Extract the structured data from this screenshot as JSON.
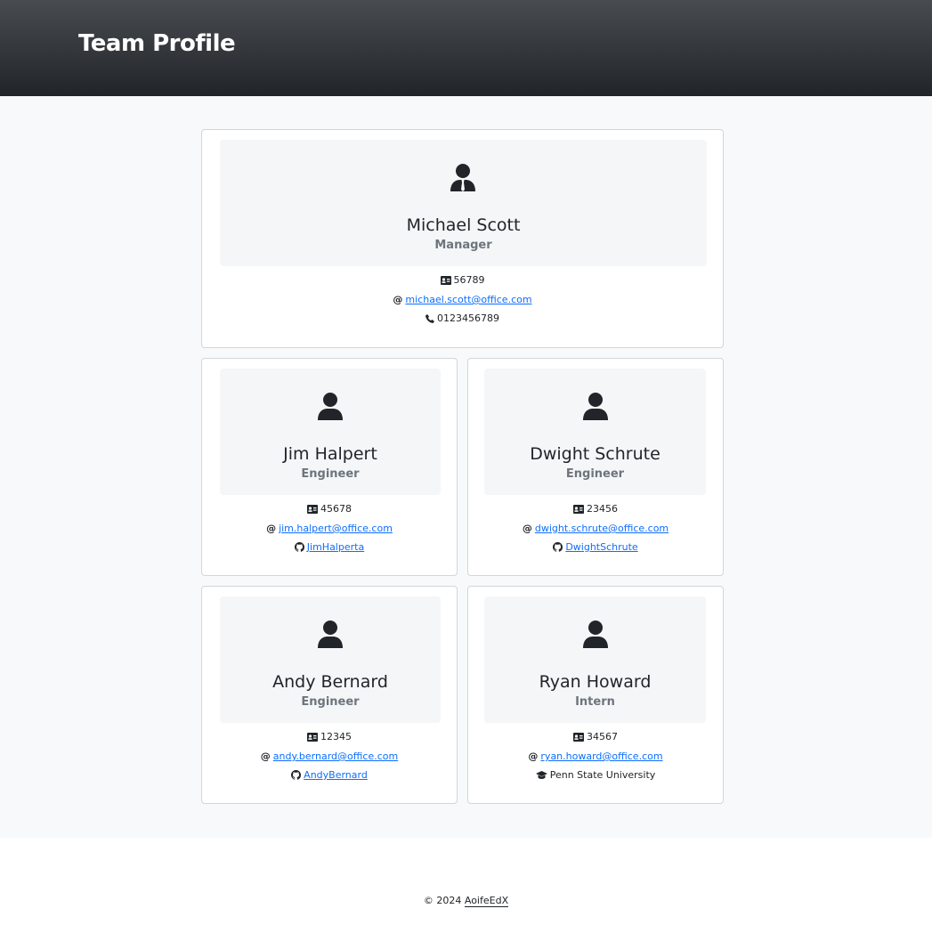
{
  "header": {
    "title": "Team Profile"
  },
  "manager": {
    "name": "Michael Scott",
    "role": "Manager",
    "id": "56789",
    "email": "michael.scott@office.com",
    "phone": "0123456789",
    "icon": "user-tie-icon"
  },
  "engineers": [
    {
      "name": "Jim Halpert",
      "role": "Engineer",
      "id": "45678",
      "email": "jim.halpert@office.com",
      "github": "JimHalperta",
      "icon": "user-icon"
    },
    {
      "name": "Dwight Schrute",
      "role": "Engineer",
      "id": "23456",
      "email": "dwight.schrute@office.com",
      "github": "DwightSchrute",
      "icon": "user-icon"
    },
    {
      "name": "Andy Bernard",
      "role": "Engineer",
      "id": "12345",
      "email": "andy.bernard@office.com",
      "github": "AndyBernard",
      "icon": "user-icon"
    }
  ],
  "intern": {
    "name": "Ryan Howard",
    "role": "Intern",
    "id": "34567",
    "email": "ryan.howard@office.com",
    "school": "Penn State University",
    "icon": "user-icon"
  },
  "footer": {
    "copyright": "© 2024",
    "author": "AoifeEdX"
  },
  "colors": {
    "header_dark": "#212529",
    "link": "#0d6efd",
    "role_gray": "#6c757d"
  }
}
